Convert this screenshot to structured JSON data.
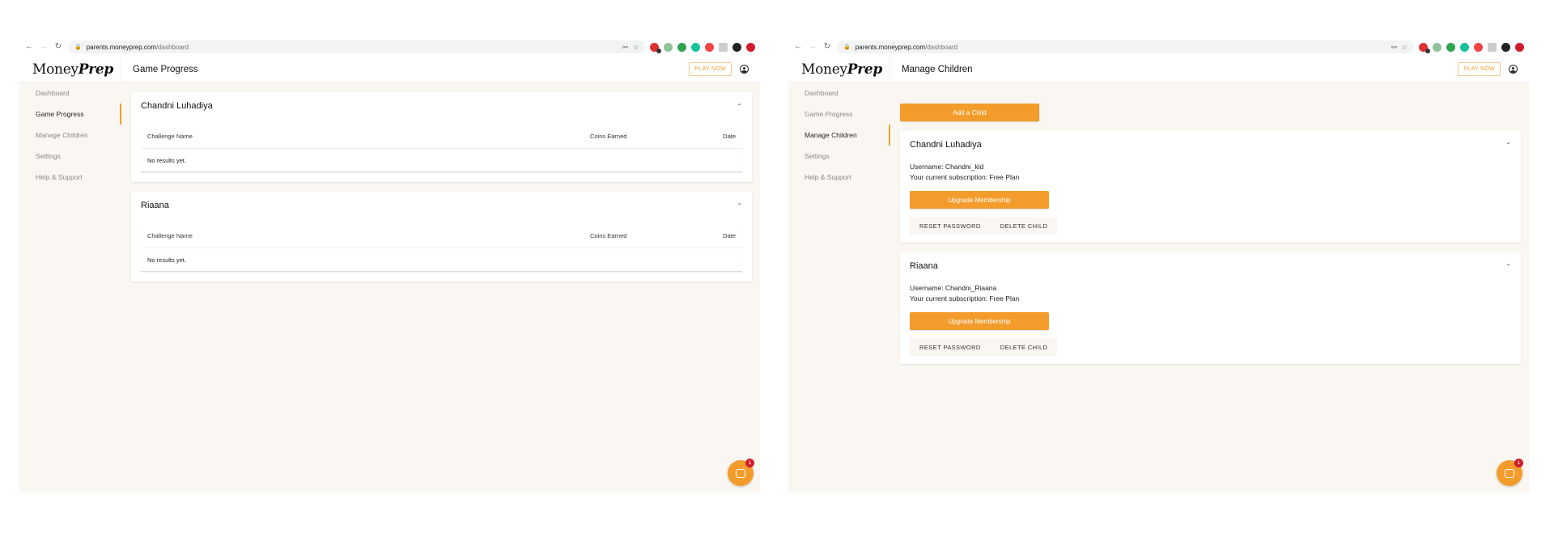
{
  "browser": {
    "host": "parents.moneyprep.com",
    "path": "/dashboard"
  },
  "app": {
    "logo_regular": "Money",
    "logo_bold": "Prep",
    "play_now": "PLAY NOW",
    "accent_color": "#f39c2b"
  },
  "sidebar": {
    "items": [
      {
        "label": "Dashboard"
      },
      {
        "label": "Game Progress"
      },
      {
        "label": "Manage Children"
      },
      {
        "label": "Settings"
      },
      {
        "label": "Help & Support"
      }
    ]
  },
  "left": {
    "page_title": "Game Progress",
    "table_headers": {
      "challenge": "Challenge Name",
      "coins": "Coins Earned",
      "date": "Date"
    },
    "children": [
      {
        "name": "Chandni Luhadiya",
        "empty": "No results yet."
      },
      {
        "name": "Riaana",
        "empty": "No results yet."
      }
    ]
  },
  "right": {
    "page_title": "Manage Children",
    "add_child": "Add a Child",
    "upgrade": "Upgrade Membership",
    "reset_password": "RESET PASSWORD",
    "delete_child": "DELETE CHILD",
    "children": [
      {
        "name": "Chandni Luhadiya",
        "username": "Username: Chandni_kid",
        "subscription": "Your current subscription: Free Plan"
      },
      {
        "name": "Riaana",
        "username": "Username: Chandni_Riaana",
        "subscription": "Your current subscription: Free Plan"
      }
    ]
  },
  "chat": {
    "badge": "1"
  }
}
